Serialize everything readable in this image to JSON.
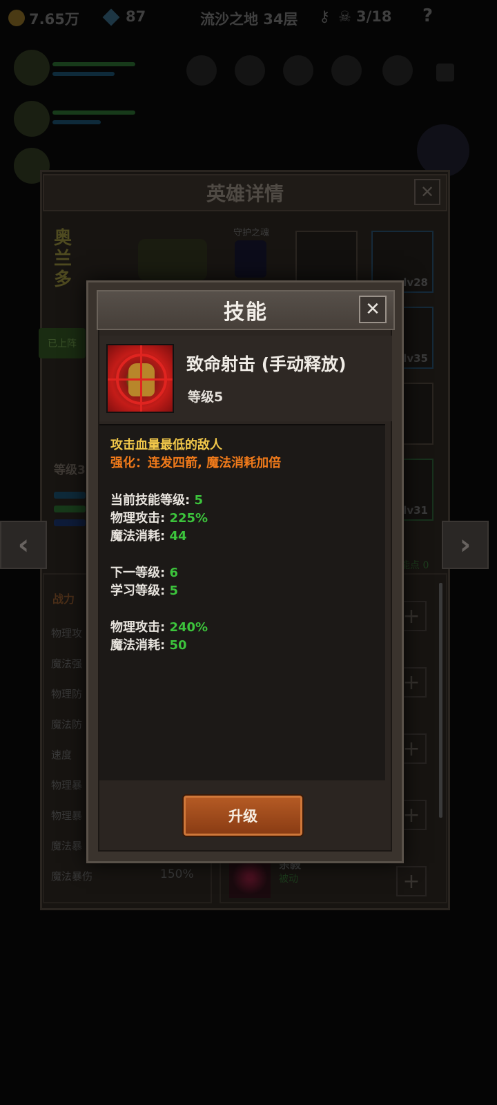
{
  "topbar": {
    "gold": "7.65万",
    "gems": "87",
    "stage": "流沙之地 34层",
    "kills": "3/18",
    "help": "?"
  },
  "hero_panel": {
    "title": "英雄详情",
    "close": "✕",
    "hero_name": "奥兰多",
    "guard_label": "守护之魂",
    "on_team": "已上阵",
    "level_label": "等级3",
    "equip_levels": [
      "lv28",
      "lv35",
      "lv31"
    ],
    "skill_points": "能点 0",
    "combat_tab": "战力",
    "stats": [
      "物理攻",
      "魔法强",
      "物理防",
      "魔法防",
      "速度",
      "物理暴",
      "物理暴",
      "魔法暴",
      "魔法暴伤"
    ],
    "last_stat_value": "150%",
    "plus": "+",
    "visible_skill_name": "余毅",
    "visible_skill_type": "被动"
  },
  "nav": {
    "prev": "‹",
    "next": "›"
  },
  "dialog": {
    "title": "技能",
    "close": "✕",
    "skill_name": "致命射击 (手动释放)",
    "skill_level": "等级5",
    "description": "攻击血量最低的敌人",
    "enhance": "强化：连发四箭, 魔法消耗加倍",
    "current": {
      "level_label": "当前技能等级: ",
      "level_value": "5",
      "atk_label": "物理攻击: ",
      "atk_value": "225%",
      "mp_label": "魔法消耗: ",
      "mp_value": "44"
    },
    "next": {
      "level_label": "下一等级: ",
      "level_value": "6",
      "learn_label": "学习等级: ",
      "learn_value": "5",
      "atk_label": "物理攻击: ",
      "atk_value": "240%",
      "mp_label": "魔法消耗: ",
      "mp_value": "50"
    },
    "upgrade_button": "升级"
  },
  "colors": {
    "value_green": "#3cc43c",
    "desc_yellow": "#f2c84a",
    "enhance_orange": "#f07a1a",
    "button_orange": "#a44c1c"
  }
}
